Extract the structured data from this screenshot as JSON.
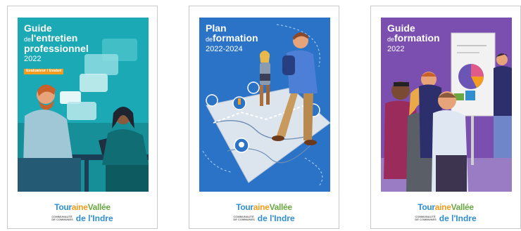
{
  "covers": [
    {
      "title_line1": "Guide",
      "title_line2_small": "de",
      "title_line2": "l'entretien",
      "title_line3": "professionnel",
      "year": "2022",
      "tag": "Evaluateur / Evalué",
      "bg_color": "#1aa9b5"
    },
    {
      "title_line1": "Plan",
      "title_line2_small": "de",
      "title_line2": "formation",
      "year": "2022-2024",
      "bg_color": "#2a73c7"
    },
    {
      "title_line1": "Guide",
      "title_line2_small": "de",
      "title_line2": "formation",
      "year": "2022",
      "bg_color": "#7b4fb0"
    }
  ],
  "logo": {
    "part1": "Tour",
    "part2": "aine",
    "part3": "Vallée",
    "sub_line1": "COMMUNAUTÉ",
    "sub_line2": "DE COMMUNES",
    "part4": "de l'Indre"
  }
}
